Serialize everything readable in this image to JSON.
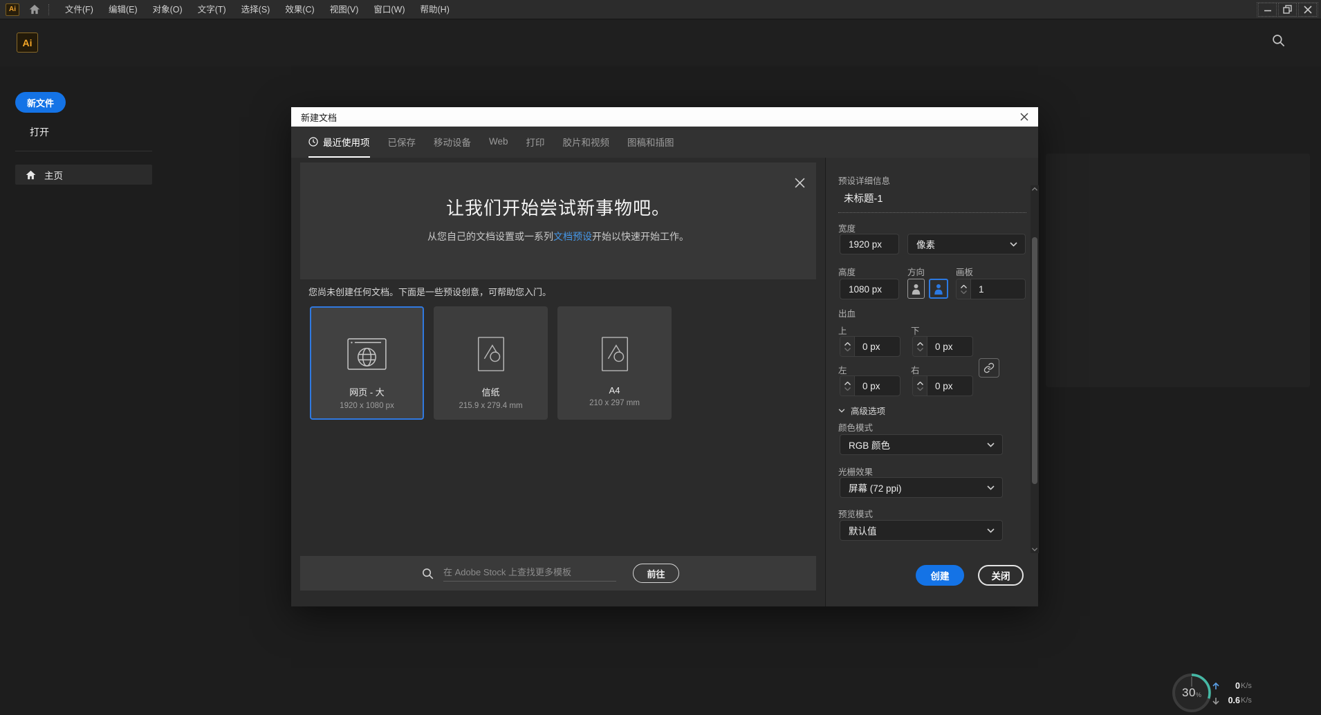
{
  "titlebar": {
    "logo": "Ai",
    "menus": [
      "文件(F)",
      "编辑(E)",
      "对象(O)",
      "文字(T)",
      "选择(S)",
      "效果(C)",
      "视图(V)",
      "窗口(W)",
      "帮助(H)"
    ]
  },
  "header": {
    "logo": "Ai"
  },
  "sidebar": {
    "new_file": "新文件",
    "open": "打开",
    "home": "主页"
  },
  "dialog": {
    "title": "新建文档",
    "tabs": [
      "最近使用项",
      "已保存",
      "移动设备",
      "Web",
      "打印",
      "胶片和视频",
      "图稿和插图"
    ],
    "banner": {
      "headline": "让我们开始尝试新事物吧。",
      "subtitle_pre": "从您自己的文档设置或一系列",
      "subtitle_link": "文档预设",
      "subtitle_post": "开始以快速开始工作。"
    },
    "hint": "您尚未创建任何文档。下面是一些预设创意，可帮助您入门。",
    "presets": [
      {
        "name": "网页 - 大",
        "size": "1920 x 1080 px",
        "selected": true
      },
      {
        "name": "信纸",
        "size": "215.9 x 279.4 mm",
        "selected": false
      },
      {
        "name": "A4",
        "size": "210 x 297 mm",
        "selected": false
      }
    ],
    "stock": {
      "placeholder": "在 Adobe Stock 上查找更多模板",
      "go": "前往"
    },
    "panel": {
      "title": "预设详细信息",
      "doc_name": "未标题-1",
      "width_label": "宽度",
      "width_value": "1920 px",
      "unit_value": "像素",
      "height_label": "高度",
      "height_value": "1080 px",
      "orientation_label": "方向",
      "artboard_label": "画板",
      "artboard_value": "1",
      "bleed_label": "出血",
      "bleed_top_label": "上",
      "bleed_top_value": "0 px",
      "bleed_bottom_label": "下",
      "bleed_bottom_value": "0 px",
      "bleed_left_label": "左",
      "bleed_left_value": "0 px",
      "bleed_right_label": "右",
      "bleed_right_value": "0 px",
      "advanced_label": "高级选项",
      "color_mode_label": "颜色模式",
      "color_mode_value": "RGB 颜色",
      "raster_label": "光栅效果",
      "raster_value": "屏幕 (72 ppi)",
      "preview_label": "预览模式",
      "preview_value": "默认值",
      "create": "创建",
      "close": "关闭"
    }
  },
  "status": {
    "percent": "30",
    "percent_unit": "%",
    "upload": "0",
    "upload_unit": "K/s",
    "download": "0.6",
    "download_unit": "K/s"
  },
  "colors": {
    "accent": "#1473e6",
    "link": "#4596e6",
    "gauge_arc": "#45b8a5",
    "selection": "#3079e0"
  }
}
